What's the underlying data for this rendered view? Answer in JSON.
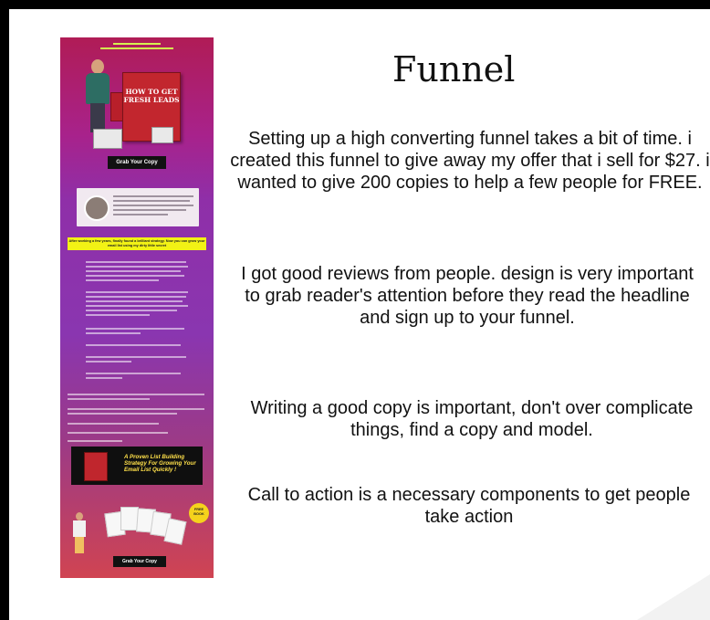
{
  "slide": {
    "title": "Funnel",
    "paragraphs": [
      "Setting up a high converting funnel takes  a bit of time. i created this funnel to give away my offer that i sell for $27. i wanted to give 200 copies to help a few people for FREE.",
      "I got good reviews from people. design is very important to grab reader's attention before they read the headline and sign up to your funnel.",
      "Writing a good copy is important, don't over complicate things, find a copy and model.",
      "Call to action is a necessary components to get people take action"
    ]
  },
  "funnel_preview": {
    "book_title": "HOW TO GET FRESH LEADS",
    "cta_button": "Grab Your Copy",
    "yellow_banner": "After working a few years, finally found a brilliant strategy. Now you can grow your email list using my dirty little secret",
    "promo_banner": "A Proven List Building Strategy For Growing Your Email List Quickly !",
    "bottom_cta_button": "Grab Your Copy",
    "badge": "FREE BOOK"
  },
  "colors": {
    "funnel_gradient_top": "#b01c56",
    "funnel_gradient_mid": "#8a36b0",
    "funnel_gradient_bottom": "#d04452",
    "promo_text": "#ffe04a",
    "banner_yellow": "#f2f215"
  }
}
